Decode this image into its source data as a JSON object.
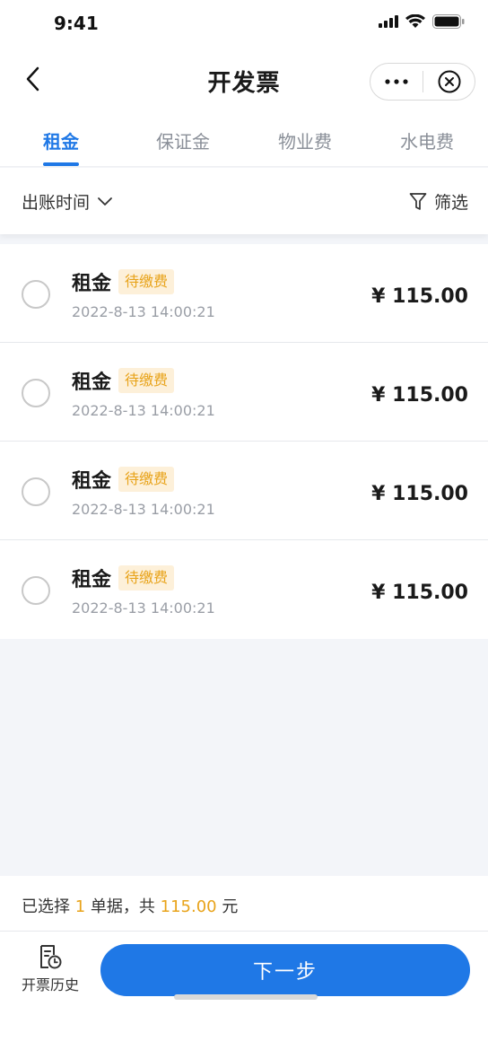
{
  "status_bar": {
    "time": "9:41"
  },
  "nav": {
    "title": "开发票"
  },
  "tabs": [
    {
      "label": "租金",
      "active": true
    },
    {
      "label": "保证金",
      "active": false
    },
    {
      "label": "物业费",
      "active": false
    },
    {
      "label": "水电费",
      "active": false
    }
  ],
  "filter_bar": {
    "sort_label": "出账时间",
    "filter_label": "筛选"
  },
  "items": [
    {
      "title": "租金",
      "badge": "待缴费",
      "date": "2022-8-13 14:00:21",
      "amount": "¥ 115.00",
      "selected": false
    },
    {
      "title": "租金",
      "badge": "待缴费",
      "date": "2022-8-13 14:00:21",
      "amount": "¥ 115.00",
      "selected": false
    },
    {
      "title": "租金",
      "badge": "待缴费",
      "date": "2022-8-13 14:00:21",
      "amount": "¥ 115.00",
      "selected": false
    },
    {
      "title": "租金",
      "badge": "待缴费",
      "date": "2022-8-13 14:00:21",
      "amount": "¥ 115.00",
      "selected": false
    }
  ],
  "summary": {
    "prefix": "已选择",
    "count": "1",
    "middle": "单据，共",
    "total": "115.00",
    "suffix": "元"
  },
  "bottom": {
    "history_label": "开票历史",
    "next_label": "下一步"
  },
  "colors": {
    "accent": "#1f78e6",
    "highlight": "#e8a31a",
    "badge_bg": "#fdf0d9"
  }
}
